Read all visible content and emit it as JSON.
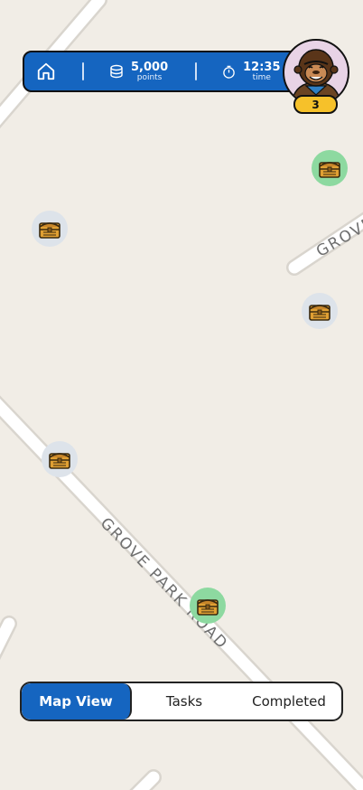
{
  "map": {
    "road_labels": [
      "GROVE PARK ROAD",
      "GROVE"
    ]
  },
  "hud": {
    "points_value": "5,000",
    "points_label": "points",
    "time_value": "12:35",
    "time_label": "time",
    "level": "3"
  },
  "markers": [
    {
      "state": "found"
    },
    {
      "state": "locked"
    },
    {
      "state": "locked"
    },
    {
      "state": "locked"
    },
    {
      "state": "found"
    }
  ],
  "tabs": {
    "map_view": "Map View",
    "tasks": "Tasks",
    "completed": "Completed"
  },
  "colors": {
    "accent": "#1565c0",
    "badge": "#f6c12a",
    "found_marker": "#8dd9a0",
    "locked_marker": "#dde3ea"
  }
}
